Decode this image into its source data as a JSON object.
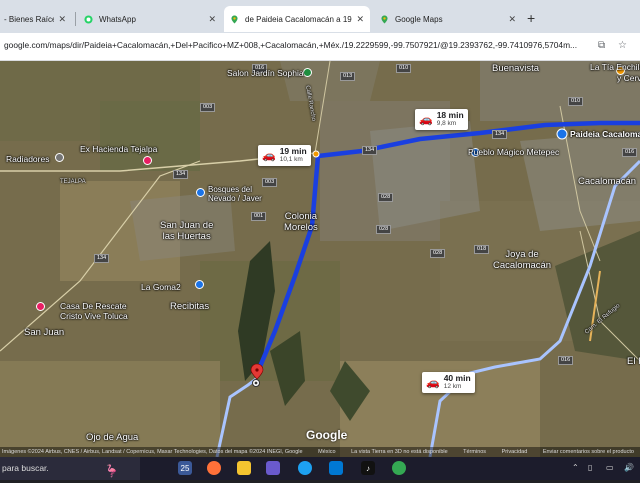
{
  "browser": {
    "tabs": [
      {
        "label": "- Bienes Raíces",
        "active": false
      },
      {
        "label": "WhatsApp",
        "active": false
      },
      {
        "label": "de Paideia Cacalomacán a 19.2",
        "active": true
      },
      {
        "label": "Google Maps",
        "active": false
      }
    ],
    "new_tab": "+",
    "url": "google.com/maps/dir/Paideia+Cacalomacán,+Del+Pacifico+MZ+008,+Cacalomacán,+Méx./19.2229599,-99.7507921/@19.2393762,-99.7410976,5704m..."
  },
  "map": {
    "place_labels": {
      "salon_jardin": "Salon Jardín Sophia",
      "buenavista": "Buenavista",
      "la_tia": "La Tía Enchiladas",
      "y_cerv": "y Cerv",
      "ex_hacienda": "Ex Hacienda Tejalpa",
      "radiadores": "Radiadores",
      "tejalpa": "TEJALPA",
      "bosques": "Bosques del\nNevado / Javer",
      "colonia_morelos": "Colonia\nMorelos",
      "pueblo_magico": "Pueblo Mágico Metepec",
      "paideia": "Paideia Cacalomacán",
      "cacalomacan": "Cacalomacán",
      "san_juan_huertas": "San Juan de\nlas Huertas",
      "joya": "Joya de\nCacalomacán",
      "la_goma": "La Goma2",
      "recibitas": "Recibitas",
      "casa_rescate": "Casa De Rescate\nCristo Vive Toluca",
      "san_juan": "San Juan",
      "ojo_de_agua": "Ojo de Agua",
      "el_r": "El R",
      "camino_rancho": "Calle Rancho",
      "camino_refugio": "Cam. El Refugio"
    },
    "road_codes": [
      "013",
      "003",
      "016",
      "134",
      "134",
      "134",
      "134",
      "001",
      "028",
      "028",
      "028",
      "018",
      "016",
      "016",
      "003",
      "010",
      "010"
    ],
    "routes": [
      {
        "time": "18 min",
        "distance": "9,8 km"
      },
      {
        "time": "19 min",
        "distance": "10,1 km"
      },
      {
        "time": "40 min",
        "distance": "12 km"
      }
    ],
    "logo": "Google",
    "footer": [
      "Imágenes ©2024 Airbus, CNES / Airbus, Landsat / Copernicus, Maxar Technologies, Datos del mapa ©2024 INEGI, Google",
      "México",
      "La vista Tierra en 3D no está disponible",
      "Términos",
      "Privacidad",
      "Enviar comentarios sobre el producto"
    ],
    "colors": {
      "route_main": "#1a3fe0",
      "route_alt": "#a9c4ff",
      "pin": "#e53935"
    }
  },
  "taskbar": {
    "search_placeholder": "para buscar.",
    "weather": "25",
    "tray_language": "ESP"
  }
}
